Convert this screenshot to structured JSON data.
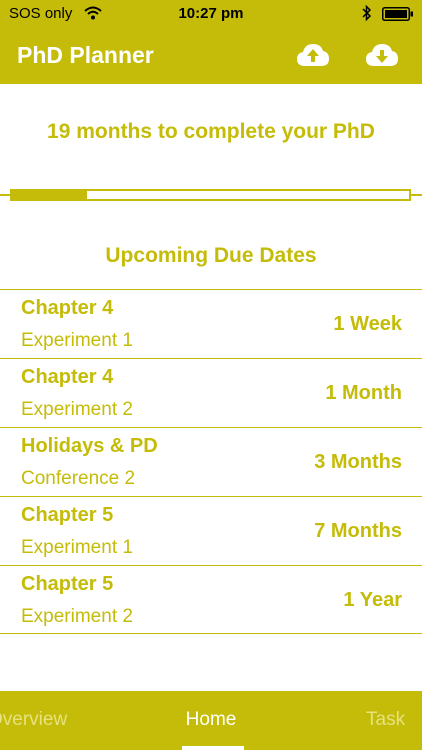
{
  "status_bar": {
    "carrier": "SOS only",
    "time": "10:27 pm",
    "wifi_icon": "wifi-icon",
    "bluetooth_icon": "bluetooth-icon",
    "battery_icon": "battery-icon"
  },
  "nav": {
    "title": "PhD Planner",
    "upload_icon": "cloud-upload-icon",
    "download_icon": "cloud-download-icon"
  },
  "summary": {
    "text": "19 months to complete your PhD",
    "progress": 0.19
  },
  "upcoming": {
    "title": "Upcoming Due Dates",
    "items": [
      {
        "title": "Chapter 4",
        "subtitle": "Experiment 1",
        "due": "1 Week"
      },
      {
        "title": "Chapter 4",
        "subtitle": "Experiment 2",
        "due": "1 Month"
      },
      {
        "title": "Holidays & PD",
        "subtitle": "Conference 2",
        "due": "3 Months"
      },
      {
        "title": "Chapter 5",
        "subtitle": "Experiment 1",
        "due": "7 Months"
      },
      {
        "title": "Chapter 5",
        "subtitle": "Experiment 2",
        "due": "1 Year"
      }
    ]
  },
  "tabs": [
    {
      "label": "Overview",
      "active": false
    },
    {
      "label": "Home",
      "active": true
    },
    {
      "label": "Task",
      "active": false
    }
  ],
  "colors": {
    "accent": "#c4bc08",
    "inactive_tab": "#e7e27f",
    "background": "#ffffff"
  }
}
